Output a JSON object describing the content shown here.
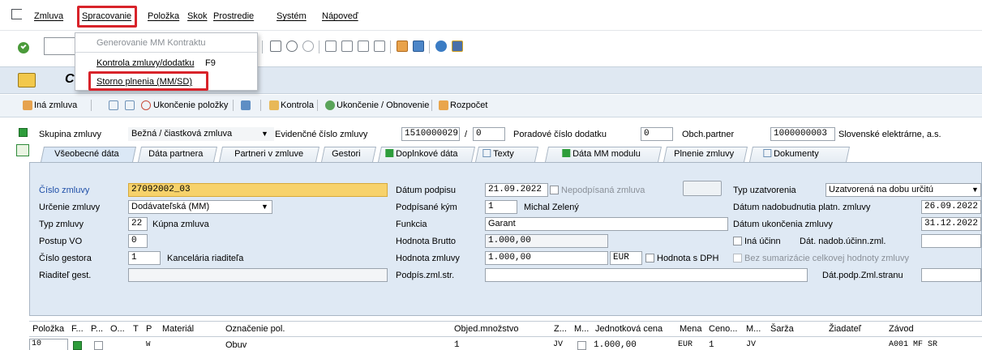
{
  "menu": {
    "items": [
      "Zmluva",
      "Spracovanie",
      "Položka",
      "Skok",
      "Prostredie",
      "Systém",
      "Nápoveď"
    ],
    "dropdown": {
      "items": [
        {
          "label": "Generovanie MM Kontraktu",
          "shortcut": "",
          "disabled": true
        },
        {
          "label": "Kontrola zmluvy/dodatku",
          "shortcut": "F9",
          "disabled": false
        },
        {
          "label": "Storno plnenia (MM/SD)",
          "shortcut": "",
          "disabled": false
        }
      ]
    }
  },
  "title_char": "C",
  "app_toolbar": {
    "other_contract": "Iná zmluva",
    "end_item": "Ukončenie položky",
    "check": "Kontrola",
    "end_renewal": "Ukončenie / Obnovenie",
    "budget": "Rozpočet"
  },
  "header": {
    "group_label": "Skupina zmluvy",
    "group_value": "Bežná / čiastková zmluva",
    "reg_label": "Evidenčné číslo zmluvy",
    "reg_value": "1510000029",
    "reg_sep": "/",
    "reg_sub": "0",
    "amend_label": "Poradové číslo dodatku",
    "amend_value": "0",
    "partner_label": "Obch.partner",
    "partner_value": "1000000003",
    "partner_name": "Slovenské elektrárne, a.s."
  },
  "tabs": [
    "Všeobecné dáta",
    "Dáta partnera",
    "Partneri v zmluve",
    "Gestori",
    "Doplnkové dáta",
    "Texty",
    "Dáta MM modulu",
    "Plnenie zmluvy",
    "Dokumenty"
  ],
  "form": {
    "contract_no_label": "Číslo zmluvy",
    "contract_no": "27092002_03",
    "purpose_label": "Určenie zmluvy",
    "purpose": "Dodávateľská (MM)",
    "type_label": "Typ zmluvy",
    "type_code": "22",
    "type_name": "Kúpna zmluva",
    "vo_label": "Postup VO",
    "vo_value": "0",
    "gestor_label": "Číslo gestora",
    "gestor_code": "1",
    "gestor_name": "Kancelária riaditeľa",
    "director_label": "Riaditeľ gest.",
    "director_value": "",
    "sign_date_label": "Dátum podpisu",
    "sign_date": "21.09.2022",
    "unsigned_label": "Nepodpísaná zmluva",
    "signed_by_label": "Podpísané kým",
    "signed_by_code": "1",
    "signed_by_name": "Michal Zelený",
    "function_label": "Funkcia",
    "function_value": "Garant",
    "gross_label": "Hodnota Brutto",
    "gross_value": "1.000,00",
    "value_label": "Hodnota zmluvy",
    "value_value": "1.000,00",
    "currency": "EUR",
    "vat_label": "Hodnota s DPH",
    "counter_sign_label": "Podpís.zml.str.",
    "counter_sign_value": "",
    "closing_type_label": "Typ uzatvorenia",
    "closing_type": "Uzatvorená na dobu určitú",
    "effective_label": "Dátum nadobudnutia platn. zmluvy",
    "effective_date": "26.09.2022",
    "end_label": "Dátum ukončenia zmluvy",
    "end_date": "31.12.2022",
    "other_effect_label": "Iná účinn",
    "effect_date_label": "Dát. nadob.účinn.zml.",
    "no_sum_label": "Bez sumarizácie celkovej hodnoty zmluvy",
    "counter_date_label": "Dát.podp.Zml.stranu"
  },
  "grid": {
    "headers": [
      "Položka",
      "F...",
      "P...",
      "O...",
      "T",
      "P",
      "Materiál",
      "Označenie pol.",
      "Objed.množstvo",
      "Z...",
      "M...",
      "Jednotková cena",
      "Mena",
      "Ceno...",
      "M...",
      "Šarža",
      "Žiadateľ",
      "Závod"
    ],
    "row": {
      "item": "10",
      "p": "W",
      "description": "Obuv",
      "qty": "1",
      "unit": "JV",
      "price": "1.000,00",
      "currency": "EUR",
      "price_unit": "1",
      "unit2": "JV",
      "plant": "A001 MF SR"
    }
  },
  "colors": {
    "highlight": "#d8232a",
    "tabs_bg": "#dfe9f4",
    "focus_field": "#f7d26b"
  }
}
